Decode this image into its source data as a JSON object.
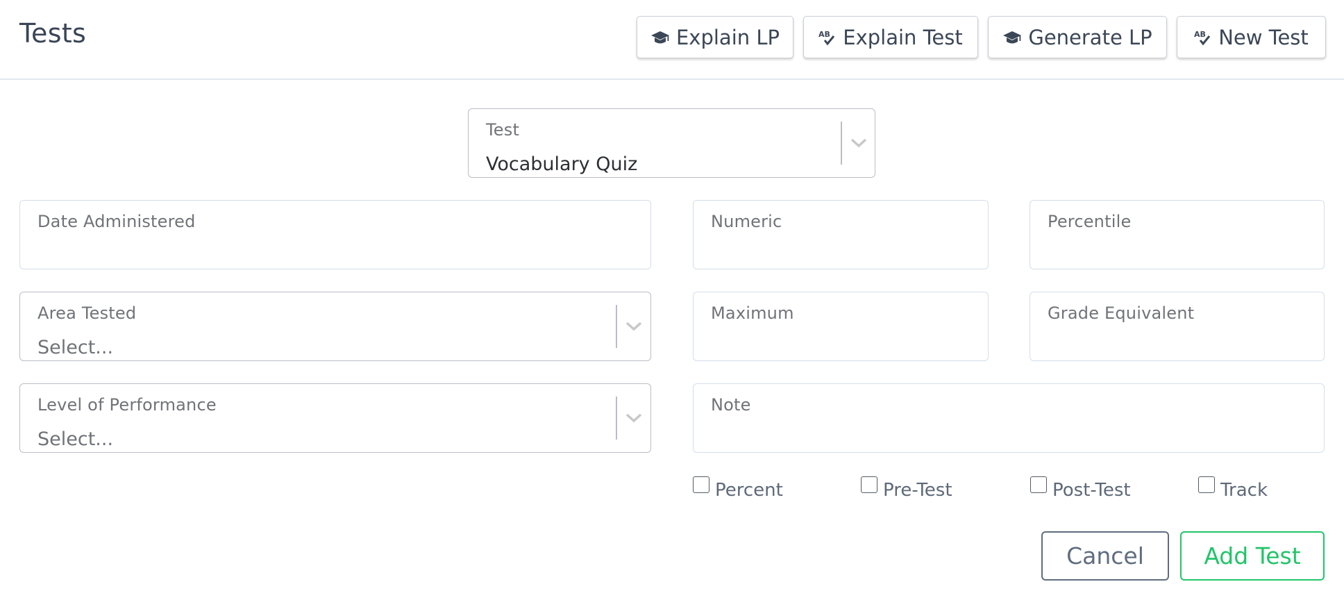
{
  "header": {
    "title": "Tests",
    "buttons": {
      "explain_lp": {
        "label": "Explain LP",
        "icon": "graduation-cap-icon"
      },
      "explain_test": {
        "label": "Explain Test",
        "icon": "spell-check-icon"
      },
      "generate_lp": {
        "label": "Generate LP",
        "icon": "graduation-cap-icon"
      },
      "new_test": {
        "label": "New Test",
        "icon": "spell-check-icon"
      }
    }
  },
  "form": {
    "test": {
      "label": "Test",
      "value": "Vocabulary Quiz"
    },
    "date_administered": {
      "label": "Date Administered",
      "value": ""
    },
    "numeric": {
      "label": "Numeric",
      "value": ""
    },
    "percentile": {
      "label": "Percentile",
      "value": ""
    },
    "area_tested": {
      "label": "Area Tested",
      "placeholder": "Select..."
    },
    "maximum": {
      "label": "Maximum",
      "value": ""
    },
    "grade_equivalent": {
      "label": "Grade Equivalent",
      "value": ""
    },
    "level_of_performance": {
      "label": "Level of Performance",
      "placeholder": "Select..."
    },
    "note": {
      "label": "Note",
      "value": ""
    },
    "checkboxes": [
      {
        "label": "Percent",
        "checked": false
      },
      {
        "label": "Pre-Test",
        "checked": false
      },
      {
        "label": "Post-Test",
        "checked": false
      },
      {
        "label": "Track",
        "checked": false
      }
    ]
  },
  "footer": {
    "cancel_label": "Cancel",
    "add_label": "Add Test"
  },
  "colors": {
    "text_dark": "#3a4556",
    "border_field": "#d4dee9",
    "border_select": "#b9bec4",
    "cancel": "#5f6d7e",
    "add": "#22c469"
  }
}
